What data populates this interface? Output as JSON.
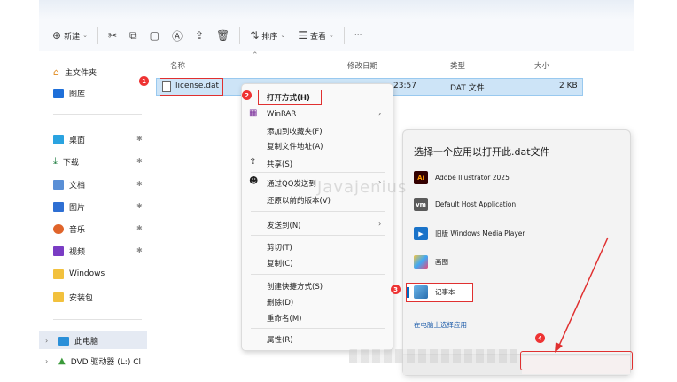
{
  "toolbar": {
    "new_label": "新建",
    "sort_label": "排序",
    "view_label": "查看",
    "more_label": "···"
  },
  "nav": {
    "items": [
      {
        "label": "主文件夹"
      },
      {
        "label": "图库"
      },
      {
        "label": "桌面"
      },
      {
        "label": "下载"
      },
      {
        "label": "文档"
      },
      {
        "label": "图片"
      },
      {
        "label": "音乐"
      },
      {
        "label": "视频"
      },
      {
        "label": "Windows"
      },
      {
        "label": "安装包"
      },
      {
        "label": "此电脑"
      },
      {
        "label": "DVD 驱动器 (L:) Cl"
      }
    ]
  },
  "columns": {
    "name": "名称",
    "modified": "修改日期",
    "type": "类型",
    "size": "大小"
  },
  "file": {
    "name": "license.dat",
    "modified": "23:57",
    "type": "DAT 文件",
    "size": "2 KB"
  },
  "badges": [
    "1",
    "2",
    "3",
    "4"
  ],
  "context_menu": {
    "items": [
      {
        "label": "打开方式(H)"
      },
      {
        "label": "WinRAR"
      },
      {
        "label": "添加到收藏夹(F)"
      },
      {
        "label": "复制文件地址(A)"
      },
      {
        "label": "共享(S)"
      },
      {
        "label": "通过QQ发送到"
      },
      {
        "label": "还原以前的版本(V)"
      },
      {
        "label": "发送到(N)"
      },
      {
        "label": "剪切(T)"
      },
      {
        "label": "复制(C)"
      },
      {
        "label": "创建快捷方式(S)"
      },
      {
        "label": "删除(D)"
      },
      {
        "label": "重命名(M)"
      },
      {
        "label": "属性(R)"
      }
    ]
  },
  "open_with": {
    "title": "选择一个应用以打开此.dat文件",
    "apps": [
      {
        "label": "Adobe Illustrator 2025",
        "icon_text": "Ai"
      },
      {
        "label": "Default Host Application",
        "icon_text": "vm"
      },
      {
        "label": "旧版 Windows Media Player",
        "icon_text": "▶"
      },
      {
        "label": "画图",
        "icon_text": ""
      },
      {
        "label": "记事本",
        "icon_text": ""
      }
    ],
    "link": "在电脑上选择应用"
  },
  "watermark": "Javajenius",
  "colors": {
    "accent": "#0067c0",
    "highlight_red": "#e03030",
    "selection": "#cde4f7"
  }
}
